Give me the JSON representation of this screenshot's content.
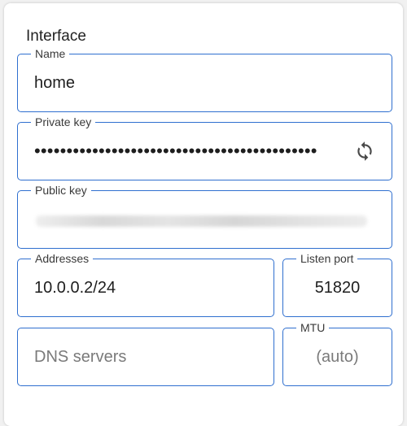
{
  "interface": {
    "section_title": "Interface",
    "name": {
      "label": "Name",
      "value": "home"
    },
    "private_key": {
      "label": "Private key",
      "value": "••••••••••••••••••••••••••••••••••••••••••••",
      "regenerate_icon": "refresh-icon"
    },
    "public_key": {
      "label": "Public key",
      "value_redacted": true
    },
    "addresses": {
      "label": "Addresses",
      "value": "10.0.0.2/24"
    },
    "listen_port": {
      "label": "Listen port",
      "value": "51820"
    },
    "dns_servers": {
      "placeholder": "DNS servers"
    },
    "mtu": {
      "label": "MTU",
      "placeholder": "(auto)"
    }
  },
  "colors": {
    "accent": "#2f6fcf",
    "text": "#1e1e1e",
    "placeholder": "#7a7a7a",
    "background": "#f1f1f1",
    "card": "#ffffff"
  }
}
